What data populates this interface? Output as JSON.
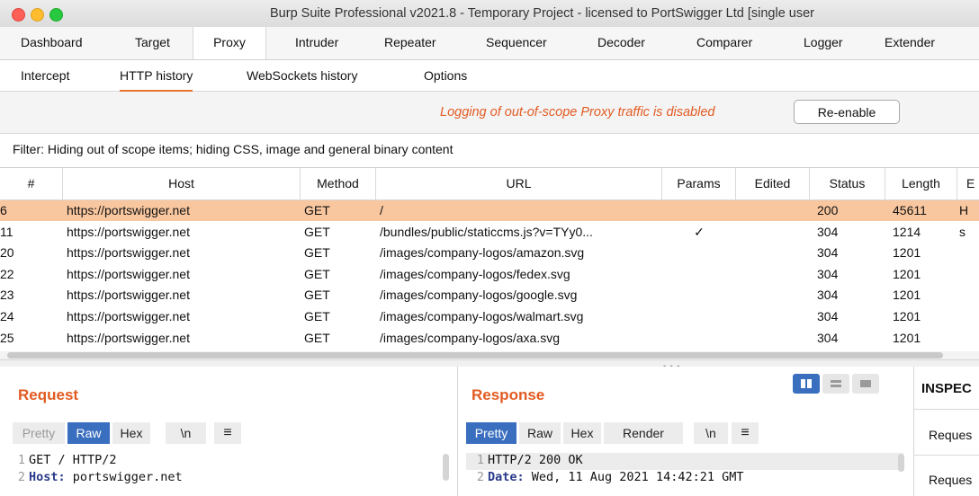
{
  "window": {
    "title": "Burp Suite Professional v2021.8 - Temporary Project - licensed to PortSwigger Ltd [single user"
  },
  "main_tabs": [
    "Dashboard",
    "Target",
    "Proxy",
    "Intruder",
    "Repeater",
    "Sequencer",
    "Decoder",
    "Comparer",
    "Logger",
    "Extender"
  ],
  "main_tab_active": "Proxy",
  "sub_tabs": [
    "Intercept",
    "HTTP history",
    "WebSockets history",
    "Options"
  ],
  "sub_tab_active": "HTTP history",
  "notice": {
    "text": "Logging of out-of-scope Proxy traffic is disabled",
    "button": "Re-enable"
  },
  "filter": {
    "text": "Filter: Hiding out of scope items;  hiding CSS, image and general binary content"
  },
  "table": {
    "columns": [
      "#",
      "Host",
      "Method",
      "URL",
      "Params",
      "Edited",
      "Status",
      "Length",
      "E"
    ],
    "rows": [
      {
        "num": "6",
        "host": "https://portswigger.net",
        "method": "GET",
        "url": "/",
        "params": "",
        "edited": "",
        "status": "200",
        "length": "45611",
        "ext": "H",
        "selected": true
      },
      {
        "num": "11",
        "host": "https://portswigger.net",
        "method": "GET",
        "url": "/bundles/public/staticcms.js?v=TYy0...",
        "params": "✓",
        "edited": "",
        "status": "304",
        "length": "1214",
        "ext": "s",
        "selected": false
      },
      {
        "num": "20",
        "host": "https://portswigger.net",
        "method": "GET",
        "url": "/images/company-logos/amazon.svg",
        "params": "",
        "edited": "",
        "status": "304",
        "length": "1201",
        "ext": "",
        "selected": false
      },
      {
        "num": "22",
        "host": "https://portswigger.net",
        "method": "GET",
        "url": "/images/company-logos/fedex.svg",
        "params": "",
        "edited": "",
        "status": "304",
        "length": "1201",
        "ext": "",
        "selected": false
      },
      {
        "num": "23",
        "host": "https://portswigger.net",
        "method": "GET",
        "url": "/images/company-logos/google.svg",
        "params": "",
        "edited": "",
        "status": "304",
        "length": "1201",
        "ext": "",
        "selected": false
      },
      {
        "num": "24",
        "host": "https://portswigger.net",
        "method": "GET",
        "url": "/images/company-logos/walmart.svg",
        "params": "",
        "edited": "",
        "status": "304",
        "length": "1201",
        "ext": "",
        "selected": false
      },
      {
        "num": "25",
        "host": "https://portswigger.net",
        "method": "GET",
        "url": "/images/company-logos/axa.svg",
        "params": "",
        "edited": "",
        "status": "304",
        "length": "1201",
        "ext": "",
        "selected": false
      }
    ]
  },
  "request": {
    "title": "Request",
    "buttons": [
      "Pretty",
      "Raw",
      "Hex",
      "\\n"
    ],
    "active": "Raw",
    "lines": [
      {
        "n": "1",
        "key": "",
        "text": "GET / HTTP/2"
      },
      {
        "n": "2",
        "key": "Host:",
        "text": " portswigger.net"
      }
    ]
  },
  "response": {
    "title": "Response",
    "buttons": [
      "Pretty",
      "Raw",
      "Hex",
      "Render",
      "\\n"
    ],
    "active": "Pretty",
    "lines": [
      {
        "n": "1",
        "key": "",
        "text": "HTTP/2 200 OK"
      },
      {
        "n": "2",
        "key": "Date:",
        "text": " Wed, 11 Aug 2021 14:42:21 GMT"
      }
    ]
  },
  "inspector": {
    "title": "INSPEC",
    "items": [
      "Reques",
      "Reques"
    ]
  },
  "colors": {
    "accent": "#e25b22",
    "selected_row": "#f9c79f",
    "button_active": "#3a6ebf"
  }
}
